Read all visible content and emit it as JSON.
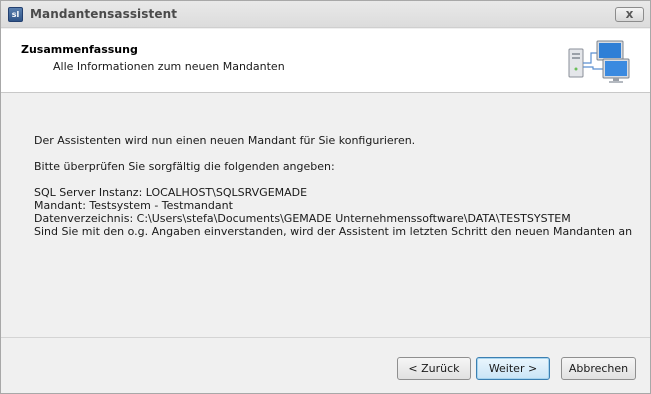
{
  "window": {
    "title": "Mandantensassistent",
    "icon": "app-icon",
    "icon_text": "sl",
    "close_label": "x"
  },
  "header": {
    "title": "Zusammenfassung",
    "subtitle": "Alle Informationen zum neuen Mandanten",
    "graphic": "network-computers-icon"
  },
  "body": {
    "intro": "Der Assistenten wird nun einen neuen Mandant für Sie konfigurieren.",
    "check_prompt": "Bitte überprüfen Sie sorgfältig die folgenden angeben:",
    "details": [
      "SQL Server Instanz: LOCALHOST\\SQLSRVGEMADE",
      "Mandant: Testsystem - Testmandant",
      "Datenverzeichnis: C:\\Users\\stefa\\Documents\\GEMADE Unternehmenssoftware\\DATA\\TESTSYSTEM",
      "Sind Sie mit den o.g. Angaben einverstanden, wird der Assistent im letzten Schritt den neuen Mandanten anlegen und konfig"
    ]
  },
  "buttons": {
    "back": "< Zurück",
    "next": "Weiter >",
    "cancel": "Abbrechen"
  },
  "colors": {
    "window_bg": "#f0f0f0",
    "header_bg": "#ffffff",
    "default_button_border": "#3c7fb1"
  }
}
